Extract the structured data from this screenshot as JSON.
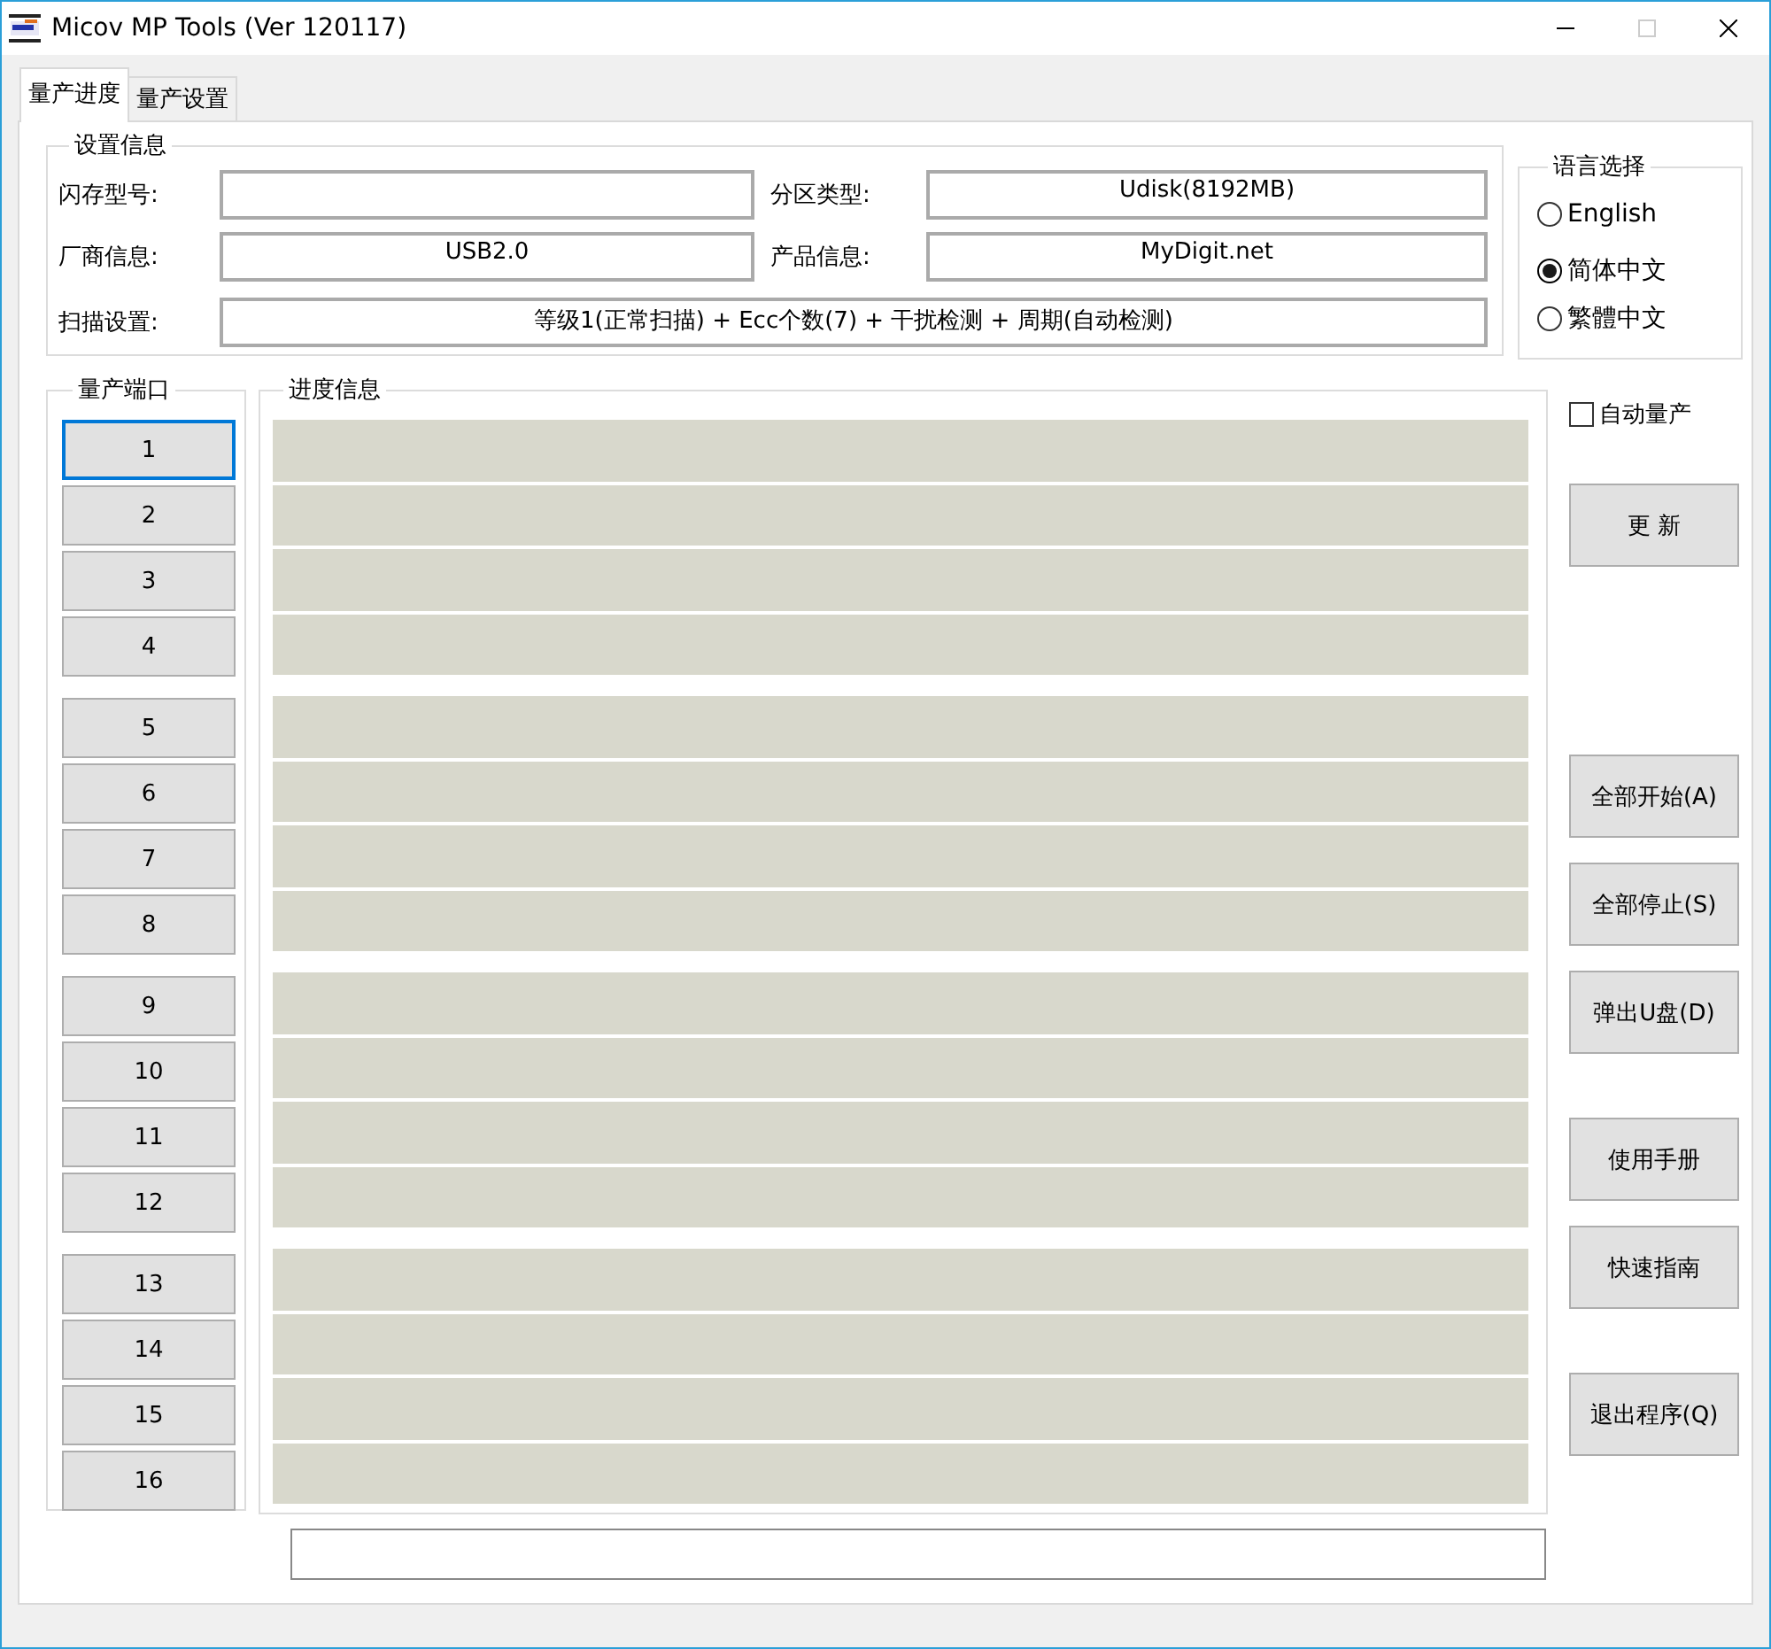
{
  "window": {
    "title": "Micov MP Tools (Ver 120117)"
  },
  "tabs": [
    {
      "label": "量产进度",
      "selected": true
    },
    {
      "label": "量产设置",
      "selected": false
    }
  ],
  "settings": {
    "title": "设置信息",
    "rows": [
      [
        {
          "label": "闪存型号:"
        },
        {
          "label": "分区类型:",
          "value": "Udisk(8192MB)"
        }
      ],
      [
        {
          "label": "厂商信息:",
          "value": "USB2.0"
        },
        {
          "label": "产品信息:",
          "value": "MyDigit.net"
        }
      ],
      [
        {
          "label": "扫描设置:",
          "value": "等级1(正常扫描) + Ecc个数(7) + 干扰检测 + 周期(自动检测)"
        }
      ]
    ]
  },
  "language": {
    "title": "语言选择",
    "options": [
      {
        "label": "English",
        "selected": false
      },
      {
        "label": "简体中文",
        "selected": true
      },
      {
        "label": "繁體中文",
        "selected": false
      }
    ]
  },
  "ports": {
    "title": "量产端口",
    "groups": [
      [
        {
          "label": "1",
          "selected": true
        },
        {
          "label": "2",
          "selected": false
        },
        {
          "label": "3",
          "selected": false
        },
        {
          "label": "4",
          "selected": false
        }
      ],
      [
        {
          "label": "5",
          "selected": false
        },
        {
          "label": "6",
          "selected": false
        },
        {
          "label": "7",
          "selected": false
        },
        {
          "label": "8",
          "selected": false
        }
      ],
      [
        {
          "label": "9",
          "selected": false
        },
        {
          "label": "10",
          "selected": false
        },
        {
          "label": "11",
          "selected": false
        },
        {
          "label": "12",
          "selected": false
        }
      ],
      [
        {
          "label": "13",
          "selected": false
        },
        {
          "label": "14",
          "selected": false
        },
        {
          "label": "15",
          "selected": false
        },
        {
          "label": "16",
          "selected": false
        }
      ]
    ]
  },
  "progress": {
    "title": "进度信息",
    "groups": [
      [
        {
          "level": 0
        },
        {
          "level": 0
        },
        {
          "level": 0
        },
        {
          "level": 0
        }
      ],
      [
        {
          "level": 0
        },
        {
          "level": 0
        },
        {
          "level": 0
        },
        {
          "level": 0
        }
      ],
      [
        {
          "level": 0
        },
        {
          "level": 0
        },
        {
          "level": 0
        },
        {
          "level": 0
        }
      ],
      [
        {
          "level": 0
        },
        {
          "level": 0
        },
        {
          "level": 0
        },
        {
          "level": 0
        }
      ]
    ]
  },
  "auto": {
    "label": "自动量产",
    "checked": false
  },
  "buttons": [
    [
      "更 新"
    ],
    [
      "全部开始(A)",
      "全部停止(S)",
      "弹出U盘(D)"
    ],
    [
      "使用手册",
      "快速指南"
    ],
    [
      "退出程序(Q)"
    ]
  ]
}
